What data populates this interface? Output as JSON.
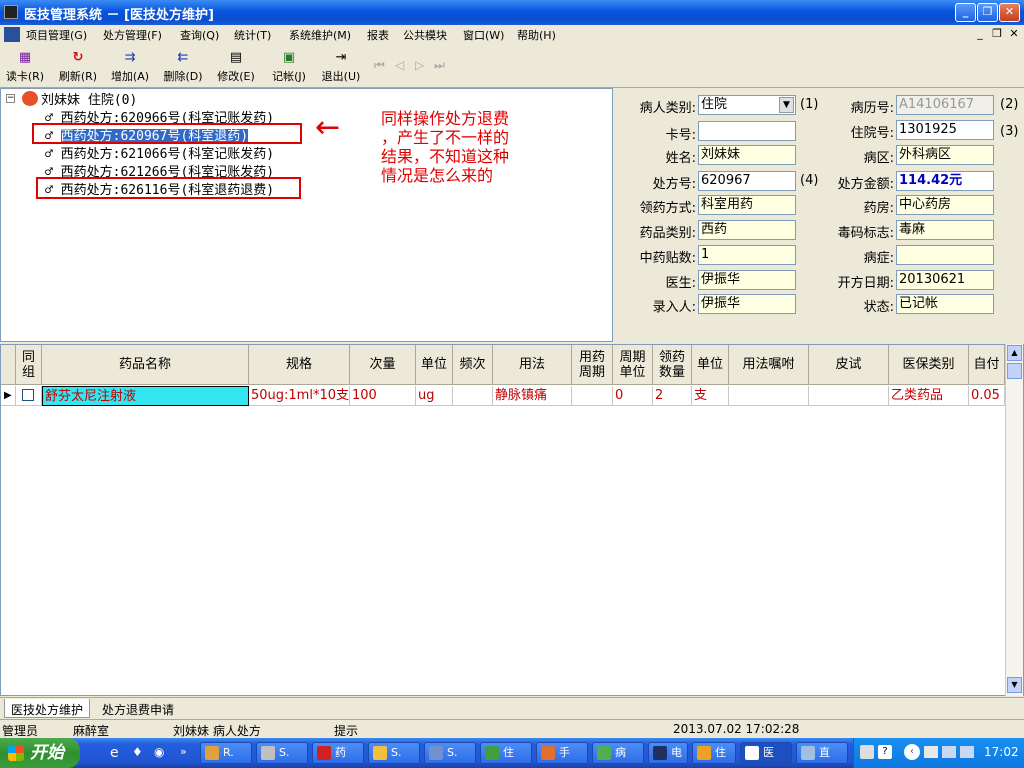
{
  "window": {
    "title": "医技管理系统 － [医技处方维护]",
    "controls": {
      "minimize": "_",
      "restore": "❐",
      "close": "✕"
    }
  },
  "menu": {
    "items": [
      "项目管理(G)",
      "处方管理(F)",
      "查询(Q)",
      "统计(T)",
      "系统维护(M)",
      "报表",
      "公共模块",
      "窗口(W)",
      "帮助(H)"
    ],
    "mdi_controls": {
      "minimize": "_",
      "restore": "❐",
      "close": "✕"
    }
  },
  "toolbar": {
    "buttons": [
      {
        "label": "读卡(R)",
        "icon": "card-reader-icon"
      },
      {
        "label": "刷新(R)",
        "icon": "refresh-icon"
      },
      {
        "label": "增加(A)",
        "icon": "add-icon"
      },
      {
        "label": "删除(D)",
        "icon": "delete-icon"
      },
      {
        "label": "修改(E)",
        "icon": "edit-icon"
      },
      {
        "label": "记帐(J)",
        "icon": "account-icon"
      },
      {
        "label": "退出(U)",
        "icon": "exit-icon"
      }
    ]
  },
  "tree": {
    "root": "刘妹妹 住院(0)",
    "items": [
      "西药处方:620966号(科室记账发药)",
      "西药处方:620967号(科室退药)",
      "西药处方:621066号(科室记账发药)",
      "西药处方:621266号(科室记账发药)",
      "西药处方:626116号(科室退药退费)"
    ],
    "selected_index": 1
  },
  "annotation": {
    "lines": [
      "同样操作处方退费",
      "，产生了不一样的",
      "结果，不知道这种",
      "情况是怎么来的"
    ],
    "arrow": "←"
  },
  "form": {
    "patient_type": {
      "label": "病人类别:",
      "value": "住院"
    },
    "record_no": {
      "label": "病历号:",
      "value": "A14106167"
    },
    "card_no": {
      "label": "卡号:",
      "value": ""
    },
    "admission_no": {
      "label": "住院号:",
      "value": "1301925"
    },
    "name": {
      "label": "姓名:",
      "value": "刘妹妹"
    },
    "ward": {
      "label": "病区:",
      "value": "外科病区"
    },
    "rx_no": {
      "label": "处方号:",
      "value": "620967"
    },
    "rx_amount": {
      "label": "处方金额:",
      "value": "114.42元"
    },
    "collect_method": {
      "label": "领药方式:",
      "value": "科室用药"
    },
    "pharmacy": {
      "label": "药房:",
      "value": "中心药房"
    },
    "drug_category": {
      "label": "药品类别:",
      "value": "西药"
    },
    "narcotic_flag": {
      "label": "毒码标志:",
      "value": "毒麻"
    },
    "tcm_doses": {
      "label": "中药贴数:",
      "value": "1"
    },
    "condition": {
      "label": "病症:",
      "value": ""
    },
    "doctor": {
      "label": "医生:",
      "value": "伊振华"
    },
    "rx_date": {
      "label": "开方日期:",
      "value": "20130621"
    },
    "entered_by": {
      "label": "录入人:",
      "value": "伊振华"
    },
    "status": {
      "label": "状态:",
      "value": "已记帐"
    },
    "notes": [
      "(1)",
      "(2)",
      "(3)",
      "(4)"
    ]
  },
  "grid": {
    "headers": [
      "同\n组",
      "药品名称",
      "规格",
      "次量",
      "单位",
      "频次",
      "用法",
      "用药\n周期",
      "周期\n单位",
      "领药\n数量",
      "单位",
      "用法嘱咐",
      "皮试",
      "医保类别",
      "自付"
    ],
    "rows": [
      [
        "",
        "舒芬太尼注射液",
        "50ug:1ml*10支",
        "100",
        "ug",
        "",
        "静脉镇痛",
        "",
        "0",
        "2",
        "支",
        "",
        "",
        "乙类药品",
        "0.05"
      ]
    ]
  },
  "tabs": [
    "医技处方维护",
    "处方退费申请"
  ],
  "status": {
    "user": "管理员",
    "dept": "麻醉室",
    "info": "刘妹妹 病人处方",
    "hint": "提示",
    "datetime": "2013.07.02 17:02:28"
  },
  "taskbar": {
    "start": "开始",
    "items": [
      "R.",
      "S.",
      "药",
      "S.",
      "S.",
      "住",
      "手",
      "病",
      "电",
      "住",
      "医",
      "直"
    ],
    "clock": "17:02"
  }
}
